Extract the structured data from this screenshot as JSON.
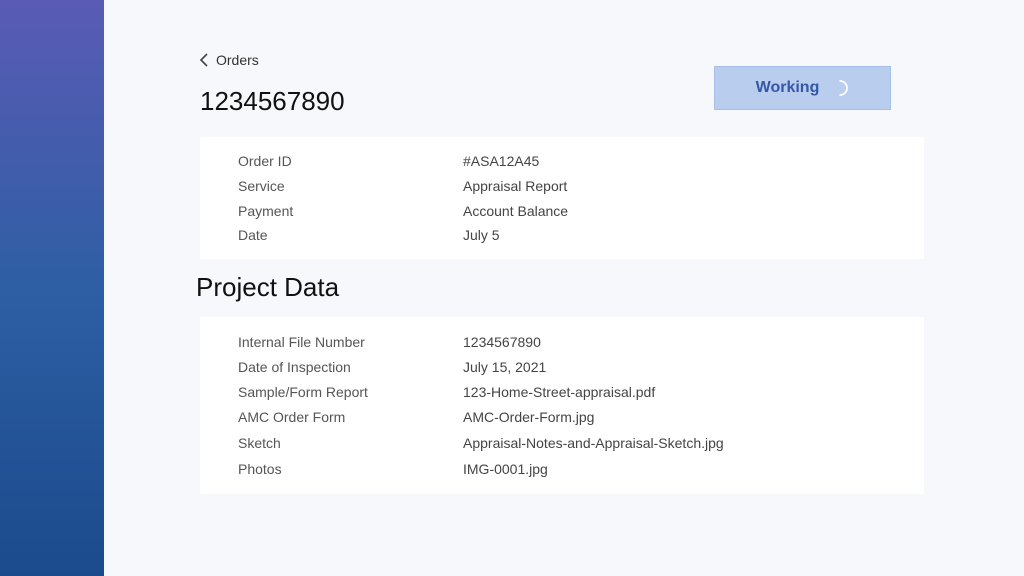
{
  "nav": {
    "back_label": "Orders"
  },
  "header": {
    "title": "1234567890",
    "status_label": "Working"
  },
  "order": {
    "rows": [
      {
        "label": "Order ID",
        "value": "#ASA12A45"
      },
      {
        "label": "Service",
        "value": "Appraisal Report"
      },
      {
        "label": "Payment",
        "value": "Account Balance"
      },
      {
        "label": "Date",
        "value": "July 5"
      }
    ]
  },
  "project": {
    "title": "Project Data",
    "rows": [
      {
        "label": "Internal File Number",
        "value": "1234567890"
      },
      {
        "label": "Date of Inspection",
        "value": "July 15, 2021"
      },
      {
        "label": "Sample/Form Report",
        "value": "123-Home-Street-appraisal.pdf"
      },
      {
        "label": "AMC Order Form",
        "value": "AMC-Order-Form.jpg"
      },
      {
        "label": "Sketch",
        "value": "Appraisal-Notes-and-Appraisal-Sketch.jpg"
      },
      {
        "label": "Photos",
        "value": "IMG-0001.jpg"
      }
    ]
  },
  "icons": {
    "back": "chevron-left-icon",
    "spinner": "spinner-icon"
  },
  "colors": {
    "sidebar_top": "#5a5bb5",
    "sidebar_bottom": "#1b4b8c",
    "status_bg": "#b9cdef",
    "status_text": "#3557a6"
  }
}
